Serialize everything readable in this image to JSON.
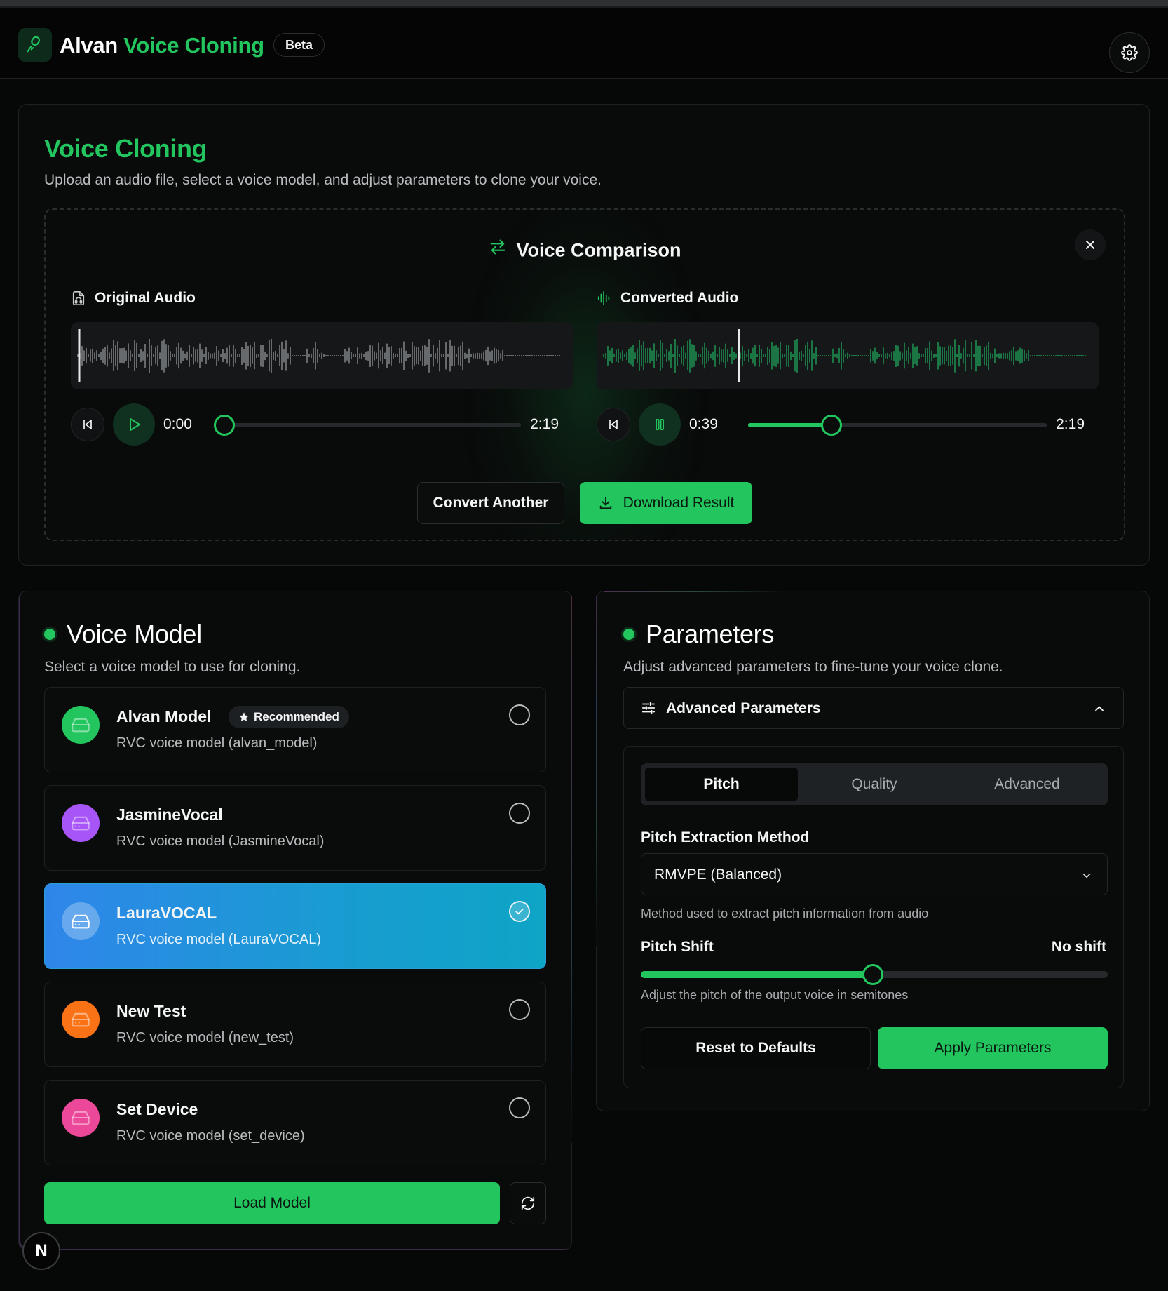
{
  "header": {
    "title_part1": "Alvan",
    "title_part2": "Voice Cloning",
    "badge": "Beta",
    "logo_icon": "microphone-icon",
    "settings_icon": "gear-icon"
  },
  "voice_cloning": {
    "title": "Voice Cloning",
    "subtitle": "Upload an audio file, select a voice model, and adjust parameters to clone your voice.",
    "comparison": {
      "title": "Voice Comparison",
      "original": {
        "label": "Original Audio",
        "current_time": "0:00",
        "total_time": "2:19",
        "progress": 0.0,
        "state": "paused"
      },
      "converted": {
        "label": "Converted Audio",
        "current_time": "0:39",
        "total_time": "2:19",
        "progress": 0.28,
        "state": "playing"
      },
      "convert_another": "Convert Another",
      "download": "Download Result"
    }
  },
  "voice_model": {
    "title": "Voice Model",
    "subtitle": "Select a voice model to use for cloning.",
    "recommended_label": "Recommended",
    "models": [
      {
        "name": "Alvan Model",
        "desc": "RVC voice model (alvan_model)",
        "color": "#22c55e",
        "selected": false,
        "recommended": true
      },
      {
        "name": "JasmineVocal",
        "desc": "RVC voice model (JasmineVocal)",
        "color": "#a855f7",
        "selected": false
      },
      {
        "name": "LauraVOCAL",
        "desc": "RVC voice model (LauraVOCAL)",
        "color": "#5b9cf0",
        "selected": true
      },
      {
        "name": "New Test",
        "desc": "RVC voice model (new_test)",
        "color": "#f97316",
        "selected": false
      },
      {
        "name": "Set Device",
        "desc": "RVC voice model (set_device)",
        "color": "#ec4899",
        "selected": false
      }
    ],
    "load_button": "Load Model"
  },
  "parameters": {
    "title": "Parameters",
    "subtitle": "Adjust advanced parameters to fine-tune your voice clone.",
    "advanced_label": "Advanced Parameters",
    "tabs": [
      "Pitch",
      "Quality",
      "Advanced"
    ],
    "active_tab": "Pitch",
    "pitch_method_label": "Pitch Extraction Method",
    "pitch_method_value": "RMVPE (Balanced)",
    "pitch_method_help": "Method used to extract pitch information from audio",
    "pitch_shift_label": "Pitch Shift",
    "pitch_shift_value": "No shift",
    "pitch_shift_level": 0.5,
    "pitch_shift_help": "Adjust the pitch of the output voice in semitones",
    "reset_button": "Reset to Defaults",
    "apply_button": "Apply Parameters"
  },
  "colors": {
    "accent": "#22c55e",
    "selected_gradient_start": "#2f86ea",
    "selected_gradient_end": "#0ea5c6"
  },
  "corner_badge": "N"
}
